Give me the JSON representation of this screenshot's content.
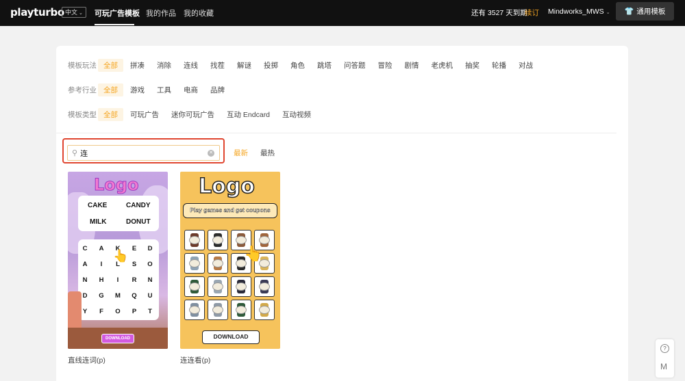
{
  "topbar": {
    "logo": "playturbo",
    "language": "中文",
    "nav": [
      "可玩广告模板",
      "我的作品",
      "我的收藏"
    ],
    "expiry": "还有 3527 天到期",
    "renew": "续订",
    "account": "Mindworks_MWS",
    "template_button": "通用模板"
  },
  "filters": {
    "gameplay": {
      "label": "模板玩法",
      "options": [
        "全部",
        "拼凑",
        "消除",
        "连线",
        "找茬",
        "解谜",
        "投掷",
        "角色",
        "跳塔",
        "问答题",
        "冒险",
        "剧情",
        "老虎机",
        "抽奖",
        "轮播",
        "对战"
      ]
    },
    "industry": {
      "label": "参考行业",
      "options": [
        "全部",
        "游戏",
        "工具",
        "电商",
        "品牌"
      ]
    },
    "type": {
      "label": "模板类型",
      "options": [
        "全部",
        "可玩广告",
        "迷你可玩广告",
        "互动 Endcard",
        "互动视频"
      ]
    }
  },
  "search": {
    "value": "连"
  },
  "sort": {
    "newest": "最新",
    "hottest": "最热"
  },
  "templates": [
    {
      "caption": "直线连词(p)",
      "logo": "Logo",
      "words": [
        "CAKE",
        "CANDY",
        "MILK",
        "DONUT"
      ],
      "grid": [
        [
          "C",
          "A",
          "K",
          "E",
          "D"
        ],
        [
          "A",
          "I",
          "L",
          "S",
          "O"
        ],
        [
          "N",
          "H",
          "I",
          "R",
          "N"
        ],
        [
          "D",
          "G",
          "M",
          "Q",
          "U"
        ],
        [
          "Y",
          "F",
          "O",
          "P",
          "T"
        ]
      ],
      "download": "DOWNLOAD"
    },
    {
      "caption": "连连看(p)",
      "logo": "Logo",
      "banner": "Play games and get coupons",
      "download": "DOWNLOAD"
    }
  ],
  "colors": {
    "accent": "#f5a623",
    "highlight_border": "#e0452f",
    "topbar": "#111111"
  },
  "help": {
    "question": "?",
    "menu": "M"
  }
}
